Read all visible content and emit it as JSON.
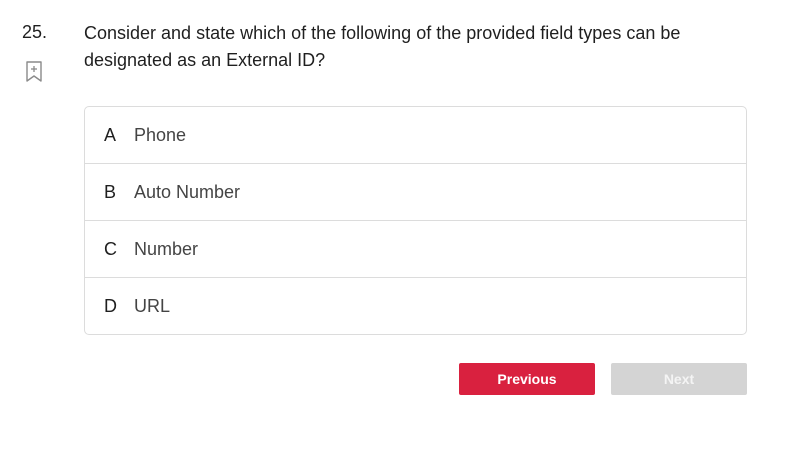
{
  "question": {
    "number": "25.",
    "text": "Consider and state which of the following of the provided field types can be designated as an External ID?"
  },
  "bookmark": {
    "icon": "bookmark-add-icon"
  },
  "options": [
    {
      "letter": "A",
      "text": "Phone"
    },
    {
      "letter": "B",
      "text": "Auto Number"
    },
    {
      "letter": "C",
      "text": "Number"
    },
    {
      "letter": "D",
      "text": "URL"
    }
  ],
  "nav": {
    "previous_label": "Previous",
    "next_label": "Next"
  },
  "colors": {
    "primary": "#d9213f",
    "disabled": "#d4d4d4",
    "border": "#dcdcdc"
  }
}
